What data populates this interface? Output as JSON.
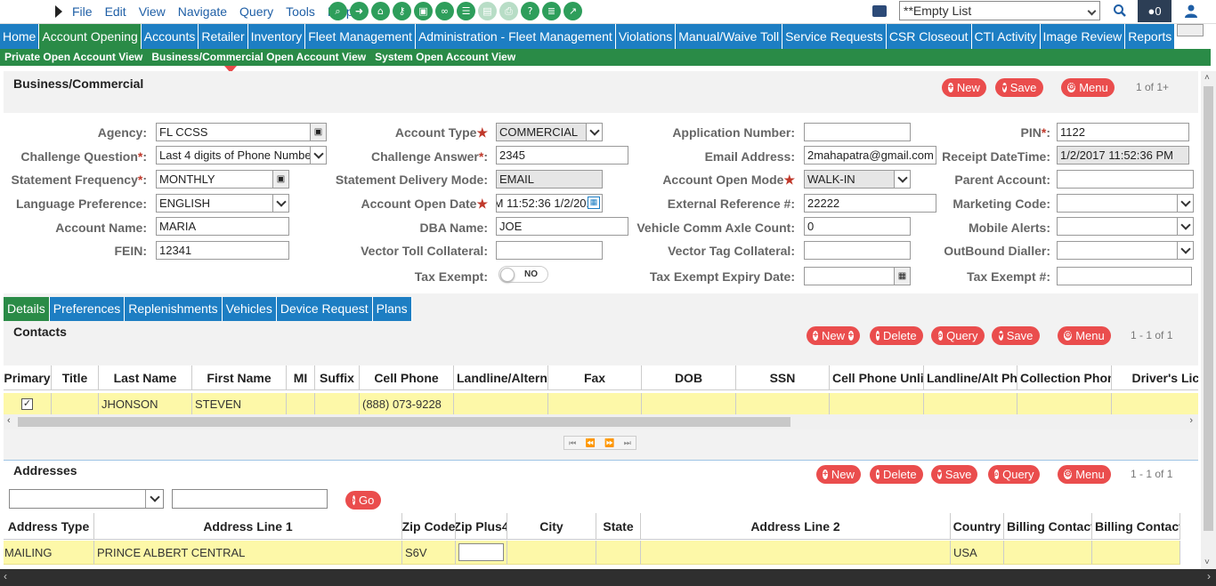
{
  "topbar": {
    "menus": [
      "File",
      "Edit",
      "View",
      "Navigate",
      "Query",
      "Tools",
      "Help"
    ],
    "list_select": "**Empty List",
    "notification_count": "0"
  },
  "nav": {
    "items": [
      "Home",
      "Account Opening",
      "Accounts",
      "Retailer",
      "Inventory",
      "Fleet Management",
      "Administration - Fleet Management",
      "Violations",
      "Manual/Waive Toll",
      "Service Requests",
      "CSR Closeout",
      "CTI Activity",
      "Image Review",
      "Reports"
    ],
    "active_index": 1
  },
  "subnav": {
    "items": [
      "Private Open Account View",
      "Business/Commercial Open Account View",
      "System Open Account View"
    ],
    "active_index": 1
  },
  "form_section": {
    "title": "Business/Commercial",
    "new_label": "New",
    "save_label": "Save",
    "menu_label": "Menu",
    "pager": "1 of 1+"
  },
  "fields": {
    "agency": {
      "label": "Agency",
      "value": "FL CCSS"
    },
    "challenge_question": {
      "label": "Challenge Question",
      "value": "Last 4 digits of Phone Number"
    },
    "statement_frequency": {
      "label": "Statement Frequency",
      "value": "MONTHLY"
    },
    "language_preference": {
      "label": "Language Preference",
      "value": "ENGLISH"
    },
    "account_name": {
      "label": "Account Name",
      "value": "MARIA"
    },
    "fein": {
      "label": "FEIN",
      "value": "12341"
    },
    "account_type": {
      "label": "Account Type",
      "value": "COMMERCIAL"
    },
    "challenge_answer": {
      "label": "Challenge Answer",
      "value": "2345"
    },
    "statement_delivery_mode": {
      "label": "Statement Delivery Mode",
      "value": "EMAIL"
    },
    "account_open_date": {
      "label": "Account Open Date",
      "value": "1/2/2017 11:52:36 PM"
    },
    "dba_name": {
      "label": "DBA Name",
      "value": "JOE"
    },
    "vector_toll_collateral": {
      "label": "Vector Toll Collateral",
      "value": ""
    },
    "tax_exempt": {
      "label": "Tax Exempt",
      "value": "NO"
    },
    "application_number": {
      "label": "Application Number",
      "value": ""
    },
    "email_address": {
      "label": "Email Address",
      "value": "2mahapatra@gmail.com"
    },
    "account_open_mode": {
      "label": "Account Open Mode",
      "value": "WALK-IN"
    },
    "external_reference": {
      "label": "External Reference #",
      "value": "22222"
    },
    "vehicle_comm_axle_count": {
      "label": "Vehicle Comm Axle Count",
      "value": "0"
    },
    "vector_tag_collateral": {
      "label": "Vector Tag Collateral",
      "value": ""
    },
    "tax_exempt_expiry_date": {
      "label": "Tax Exempt Expiry Date",
      "value": ""
    },
    "pin": {
      "label": "PIN",
      "value": "1122"
    },
    "receipt_datetime": {
      "label": "Receipt DateTime",
      "value": "1/2/2017 11:52:36 PM"
    },
    "parent_account": {
      "label": "Parent Account",
      "value": ""
    },
    "marketing_code": {
      "label": "Marketing Code",
      "value": ""
    },
    "mobile_alerts": {
      "label": "Mobile Alerts",
      "value": ""
    },
    "outbound_dialler": {
      "label": "OutBound Dialler",
      "value": ""
    },
    "tax_exempt_number": {
      "label": "Tax Exempt #",
      "value": ""
    }
  },
  "tabs": [
    "Details",
    "Preferences",
    "Replenishments",
    "Vehicles",
    "Device Request",
    "Plans"
  ],
  "contacts": {
    "title": "Contacts",
    "new_label": "New",
    "delete_label": "Delete",
    "query_label": "Query",
    "save_label": "Save",
    "menu_label": "Menu",
    "pager": "1 - 1 of 1",
    "columns": [
      "Primary",
      "Title",
      "Last Name",
      "First Name",
      "MI",
      "Suffix",
      "Cell Phone",
      "Landline/Alterna",
      "Fax",
      "DOB",
      "SSN",
      "Cell Phone Unlist",
      "Landline/Alt Pho",
      "Collection Phone",
      "Driver's Lice"
    ],
    "rows": [
      {
        "primary": "✓",
        "title": "",
        "last_name": "JHONSON",
        "first_name": "STEVEN",
        "mi": "",
        "suffix": "",
        "cell_phone": "(888) 073-9228",
        "landline": "",
        "fax": "",
        "dob": "",
        "ssn": "",
        "cell_unlisted": "",
        "landline_alt": "",
        "collection_phone": "",
        "drivers_license": ""
      }
    ]
  },
  "addresses": {
    "title": "Addresses",
    "new_label": "New",
    "delete_label": "Delete",
    "save_label": "Save",
    "query_label": "Query",
    "menu_label": "Menu",
    "pager": "1 - 1 of 1",
    "go_label": "Go",
    "columns": [
      "Address Type",
      "Address Line 1",
      "Zip Code",
      "Zip Plus4",
      "City",
      "State",
      "Address Line 2",
      "Country",
      "Billing Contact I",
      "Billing Contact"
    ],
    "rows": [
      {
        "address_type": "MAILING",
        "address_line1": "PRINCE ALBERT CENTRAL",
        "zip_code": "S6V",
        "zip_plus4": "",
        "city": "",
        "state": "",
        "address_line2": "",
        "country": "USA",
        "billing_contact_i": "",
        "billing_contact": ""
      }
    ]
  },
  "colors": {
    "nav_blue": "#1d7ec3",
    "active_green": "#2a8b47",
    "button_red": "#ea4d4d",
    "row_yellow": "#fdf8a8"
  }
}
